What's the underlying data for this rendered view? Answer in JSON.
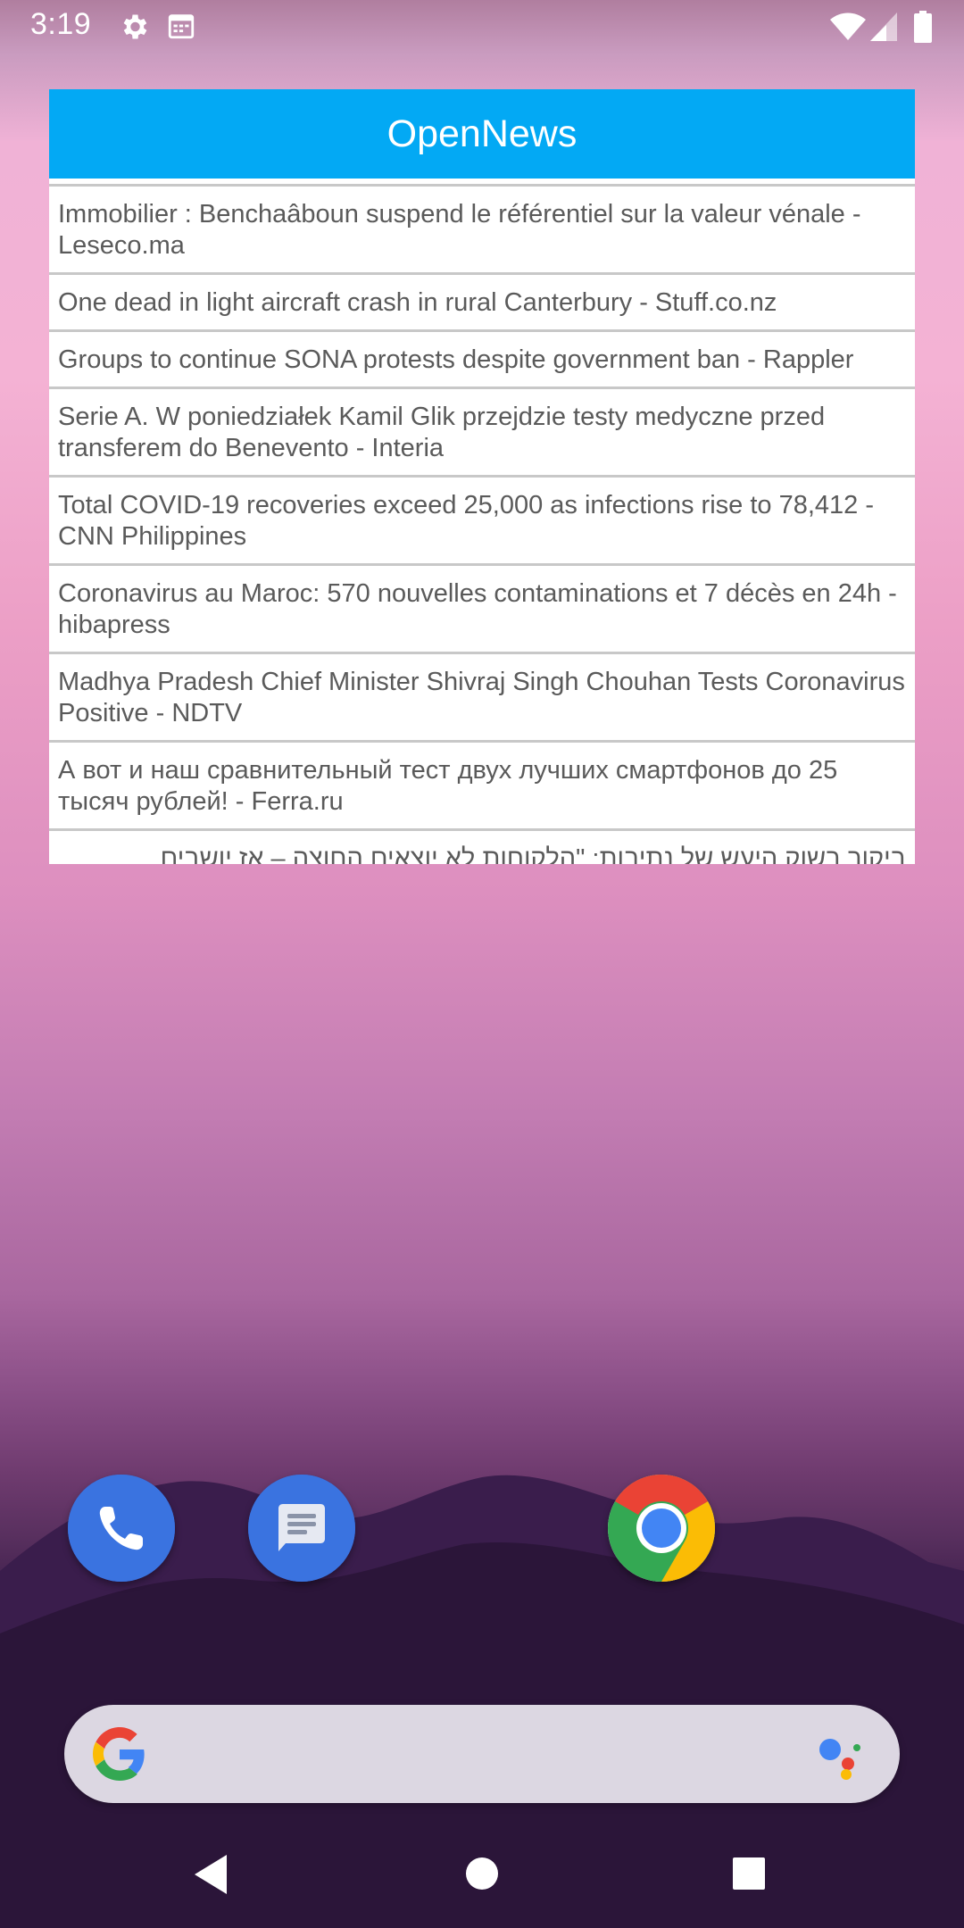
{
  "status_bar": {
    "time": "3:19",
    "icons": [
      "settings-icon",
      "calendar-icon",
      "wifi-icon",
      "cell-signal-icon",
      "battery-icon"
    ]
  },
  "widget": {
    "title": "OpenNews",
    "header_color": "#03a9f4",
    "items": [
      "Immobilier : Benchaâboun suspend le référentiel sur la valeur vénale - Leseco.ma",
      "One dead in light aircraft crash in rural Canterbury - Stuff.co.nz",
      "Groups to continue SONA protests despite government ban - Rappler",
      "Serie A. W poniedziałek Kamil Glik przejdzie testy medyczne przed transferem do Benevento - Interia",
      "Total COVID-19 recoveries exceed 25,000 as infections rise to 78,412 - CNN Philippines",
      "Coronavirus au Maroc: 570 nouvelles contaminations et 7 décès en 24h - hibapress",
      "Madhya Pradesh Chief Minister Shivraj Singh Chouhan Tests Coronavirus Positive - NDTV",
      "А вот и наш сравнительный тест двух лучших смартфонов до 25 тысяч рублей! - Ferra.ru",
      "ביקור בשוק היעש של נתיבות: \"הלקוחות לא יוצאים החוצה – אז יושבים"
    ]
  },
  "dock": {
    "apps": [
      "phone-icon",
      "messages-icon",
      "chrome-icon"
    ]
  },
  "search_bar": {
    "icons": [
      "google-logo-icon",
      "google-assistant-icon"
    ]
  },
  "nav_bar": {
    "icons": [
      "back-icon",
      "home-icon",
      "recents-icon"
    ]
  }
}
